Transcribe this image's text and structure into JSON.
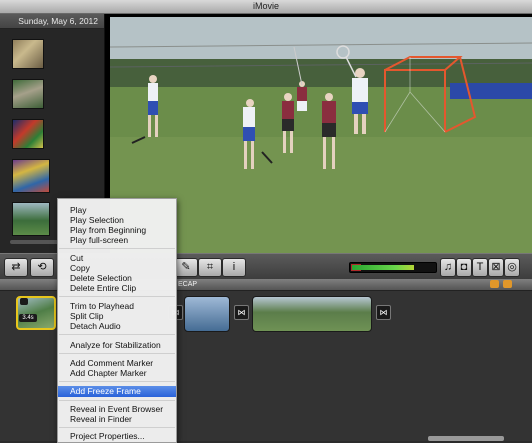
{
  "window": {
    "title": "iMovie"
  },
  "event_library": {
    "date_header": "Sunday, May 6, 2012"
  },
  "project": {
    "header_label": "ECAP",
    "clip_duration": "3.4s"
  },
  "toolbar": {
    "icons": [
      "undo-icon",
      "voiceover-icon",
      "crop-icon",
      "inspector-icon",
      "music-icon",
      "photo-icon",
      "title-icon",
      "transition-icon",
      "map-icon"
    ],
    "title_button_glyph": "T",
    "info_glyph": "i"
  },
  "context_menu": {
    "playback": [
      "Play",
      "Play Selection",
      "Play from Beginning",
      "Play full-screen"
    ],
    "edit": [
      "Cut",
      "Copy",
      "Delete Selection",
      "Delete Entire Clip"
    ],
    "trim": [
      "Trim to Playhead",
      "Split Clip",
      "Detach Audio"
    ],
    "stabilize": [
      "Analyze for Stabilization"
    ],
    "markers": [
      "Add Comment Marker",
      "Add Chapter Marker"
    ],
    "freeze": [
      "Add Freeze Frame"
    ],
    "reveal": [
      "Reveal in Event Browser",
      "Reveal in Finder"
    ],
    "properties": [
      "Project Properties..."
    ],
    "highlighted_item": "Add Freeze Frame"
  },
  "colors": {
    "menu_highlight": "#2a62d9",
    "selection_border": "#e8c61c",
    "accent_orange": "#e0972a"
  }
}
